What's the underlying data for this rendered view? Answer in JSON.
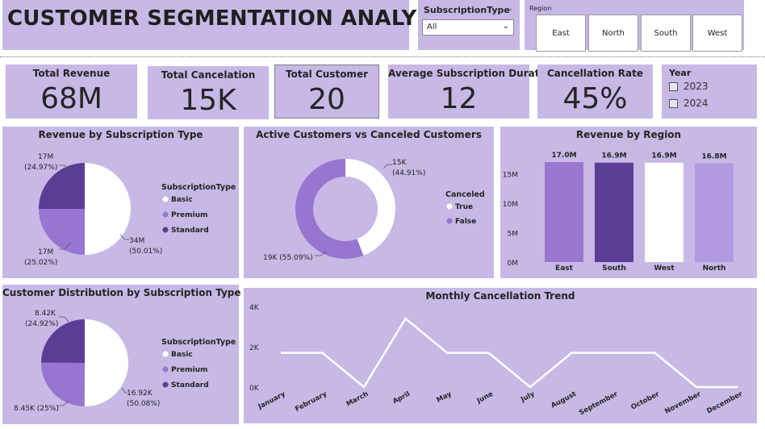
{
  "header": {
    "title": "CUSTOMER SEGMENTATION ANALYSIS"
  },
  "slicers": {
    "subscription": {
      "label": "SubscriptionType",
      "value": "All"
    },
    "region": {
      "label": "Region",
      "buttons": [
        "East",
        "North",
        "South",
        "West"
      ]
    },
    "year": {
      "label": "Year",
      "options": [
        "2023",
        "2024"
      ]
    }
  },
  "kpis": [
    {
      "title": "Total Revenue",
      "value": "68M"
    },
    {
      "title": "Total Cancelation",
      "value": "15K"
    },
    {
      "title": "Total Customer",
      "value": "20"
    },
    {
      "title": "Average Subscription Duration",
      "value": "12"
    },
    {
      "title": "Cancellation Rate",
      "value": "45%"
    }
  ],
  "colors": {
    "panel": "#c8b8e6",
    "basic": "#ffffff",
    "premium": "#9676d0",
    "standard": "#5c3d96",
    "east": "#9a78d2",
    "south": "#5c3d96",
    "west": "#ffffff",
    "north": "#b19ae0",
    "line": "#ffffff"
  },
  "chart_data": [
    {
      "type": "pie",
      "title": "Revenue by Subscription Type",
      "legend_title": "SubscriptionType",
      "slices": [
        {
          "name": "Basic",
          "value": 34,
          "label": "34M\n(50.01%)"
        },
        {
          "name": "Premium",
          "value": 17,
          "label": "17M\n(25.02%)"
        },
        {
          "name": "Standard",
          "value": 17,
          "label": "17M\n(24.97%)"
        }
      ],
      "unit": "M"
    },
    {
      "type": "pie",
      "title": "Active Customers vs Canceled Customers",
      "legend_title": "Canceled",
      "donut": true,
      "slices": [
        {
          "name": "True",
          "value": 15,
          "label": "15K\n(44.91%)"
        },
        {
          "name": "False",
          "value": 19,
          "label": "19K (55.09%)"
        }
      ]
    },
    {
      "type": "bar",
      "title": "Revenue by Region",
      "categories": [
        "East",
        "South",
        "West",
        "North"
      ],
      "values": [
        17.0,
        16.9,
        16.9,
        16.8
      ],
      "data_labels": [
        "17.0M",
        "16.9M",
        "16.9M",
        "16.8M"
      ],
      "yticks": [
        "0M",
        "5M",
        "10M",
        "15M"
      ],
      "ylim": [
        0,
        17
      ]
    },
    {
      "type": "pie",
      "title": "Customer Distribution by Subscription Type",
      "legend_title": "SubscriptionType",
      "slices": [
        {
          "name": "Basic",
          "value": 16.92,
          "label": "16.92K\n(50.08%)"
        },
        {
          "name": "Premium",
          "value": 8.45,
          "label": "8.45K (25%)"
        },
        {
          "name": "Standard",
          "value": 8.42,
          "label": "8.42K\n(24.92%)"
        }
      ]
    },
    {
      "type": "line",
      "title": "Monthly Cancellation Trend",
      "categories": [
        "January",
        "February",
        "March",
        "April",
        "May",
        "June",
        "July",
        "August",
        "September",
        "October",
        "November",
        "December"
      ],
      "values": [
        1700,
        1700,
        0,
        3400,
        1700,
        1700,
        0,
        1700,
        1700,
        1700,
        0,
        0
      ],
      "yticks": [
        "0K",
        "2K",
        "4K"
      ],
      "ylim": [
        0,
        4000
      ]
    }
  ]
}
